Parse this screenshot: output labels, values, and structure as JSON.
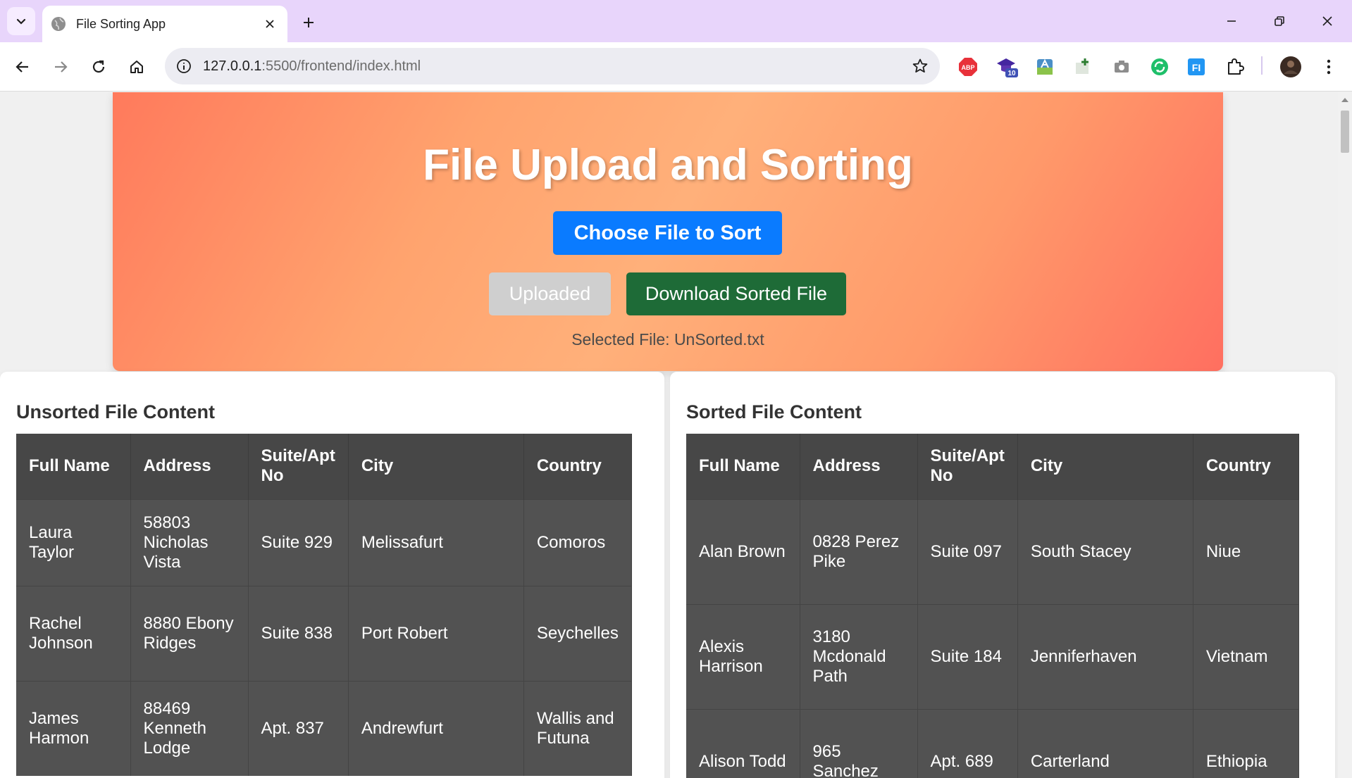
{
  "browser": {
    "tab_title": "File Sorting App",
    "url_host": "127.0.0.1",
    "url_path": ":5500/frontend/index.html",
    "extensions": [
      "abp-icon",
      "graduation-cap-icon",
      "translate-icon",
      "sheet-add-icon",
      "camera-icon",
      "sync-icon",
      "fi-icon",
      "puzzle-icon"
    ],
    "ext_badge_abp": "ABP",
    "ext_badge_count": "10",
    "ext_fi_label": "FI"
  },
  "header": {
    "title": "File Upload and Sorting",
    "choose_label": "Choose File to Sort",
    "uploaded_label": "Uploaded",
    "download_label": "Download Sorted File",
    "selected_file": "Selected File: UnSorted.txt"
  },
  "unsorted": {
    "heading": "Unsorted File Content",
    "columns": [
      "Full Name",
      "Address",
      "Suite/Apt No",
      "City",
      "Country"
    ],
    "rows": [
      [
        "Laura Taylor",
        "58803 Nicholas Vista",
        "Suite 929",
        "Melissafurt",
        "Comoros"
      ],
      [
        "Rachel Johnson",
        "8880 Ebony Ridges",
        "Suite 838",
        "Port Robert",
        "Seychelles"
      ],
      [
        "James Harmon",
        "88469 Kenneth Lodge",
        "Apt. 837",
        "Andrewfurt",
        "Wallis and Futuna"
      ]
    ]
  },
  "sorted": {
    "heading": "Sorted File Content",
    "columns": [
      "Full Name",
      "Address",
      "Suite/Apt No",
      "City",
      "Country"
    ],
    "rows": [
      [
        "Alan Brown",
        "0828 Perez Pike",
        "Suite 097",
        "South Stacey",
        "Niue"
      ],
      [
        "Alexis Harrison",
        "3180 Mcdonald Path",
        "Suite 184",
        "Jenniferhaven",
        "Vietnam"
      ],
      [
        "Alison Todd",
        "965 Sanchez",
        "Apt. 689",
        "Carterland",
        "Ethiopia"
      ]
    ]
  }
}
